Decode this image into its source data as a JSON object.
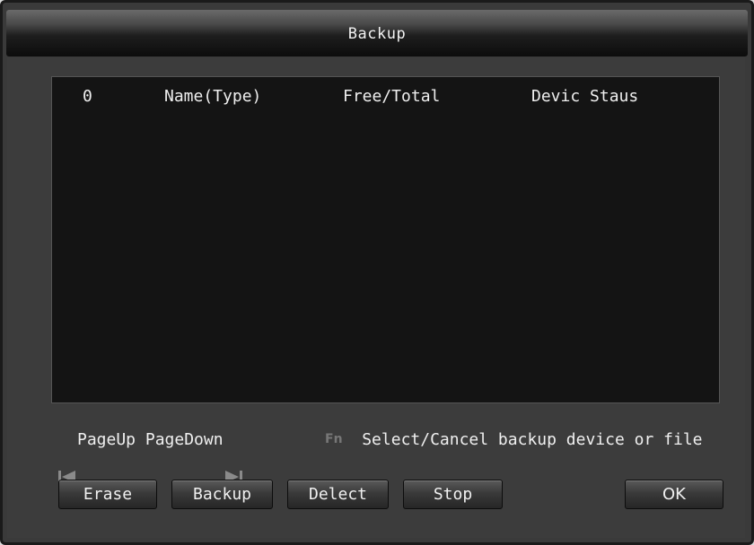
{
  "window": {
    "title": "Backup"
  },
  "table": {
    "columns": [
      "0",
      "Name(Type)",
      "Free/Total",
      "Devic Staus"
    ],
    "rows": []
  },
  "hints": {
    "page_up": "PageUp",
    "page_down": "PageDown",
    "fn_label": "Fn",
    "fn_text": "Select/Cancel backup device or file"
  },
  "buttons": {
    "erase": "Erase",
    "backup": "Backup",
    "delect": "Delect",
    "stop": "Stop",
    "ok": "OK"
  },
  "icons": {
    "prev": "skip-previous-icon",
    "next": "skip-next-icon",
    "fn": "fn-key-icon"
  }
}
